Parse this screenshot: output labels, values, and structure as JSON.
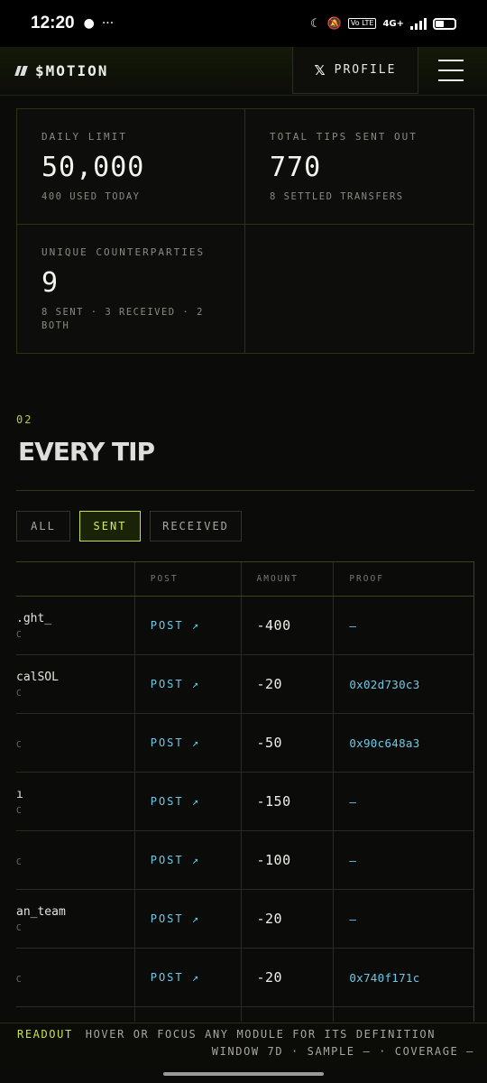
{
  "status_bar": {
    "time": "12:20",
    "network": "4G+",
    "volte": "Vo LTE"
  },
  "header": {
    "brand": "$MOTION",
    "profile_label": "PROFILE"
  },
  "stats": [
    {
      "label": "DAILY LIMIT",
      "value": "50,000",
      "sub": "400 USED TODAY"
    },
    {
      "label": "TOTAL TIPS SENT OUT",
      "value": "770",
      "sub": "8 SETTLED TRANSFERS"
    },
    {
      "label": "UNIQUE COUNTERPARTIES",
      "value": "9",
      "sub": "8 SENT · 3 RECEIVED · 2 BOTH"
    }
  ],
  "section": {
    "number": "02",
    "title": "EVERY TIP"
  },
  "filters": {
    "all": "ALL",
    "sent": "SENT",
    "received": "RECEIVED",
    "active": "SENT"
  },
  "table": {
    "headers": {
      "counterparty": "",
      "post": "POST",
      "amount": "AMOUNT",
      "proof": "PROOF"
    },
    "post_label": "POST ↗",
    "rows": [
      {
        "name": ".ght_",
        "sub": "C",
        "amount": "-400",
        "proof": "—"
      },
      {
        "name": "calSOL",
        "sub": "C",
        "amount": "-20",
        "proof": "0x02d730c3"
      },
      {
        "name": "",
        "sub": "C",
        "amount": "-50",
        "proof": "0x90c648a3"
      },
      {
        "name": "ı",
        "sub": "C",
        "amount": "-150",
        "proof": "—"
      },
      {
        "name": "",
        "sub": "C",
        "amount": "-100",
        "proof": "—"
      },
      {
        "name": "an_team",
        "sub": "C",
        "amount": "-20",
        "proof": "—"
      },
      {
        "name": "",
        "sub": "C",
        "amount": "-20",
        "proof": "0x740f171c"
      }
    ]
  },
  "footer": {
    "readout": "READOUT",
    "hint": "HOVER OR FOCUS ANY MODULE FOR ITS DEFINITION",
    "meta": "WINDOW 7D · SAMPLE — · COVERAGE —"
  }
}
